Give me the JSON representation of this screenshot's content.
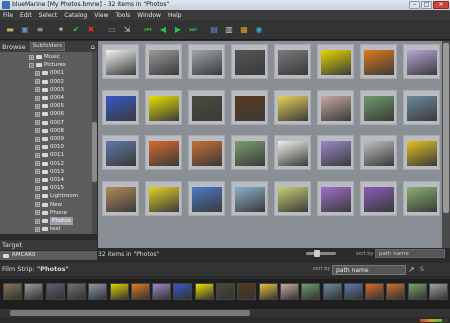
{
  "window": {
    "title": "blueMarine [My Photos.bmrw] - 32 items in \"Photos\""
  },
  "menu": [
    "File",
    "Edit",
    "Select",
    "Catalog",
    "View",
    "Tools",
    "Window",
    "Help"
  ],
  "toolbar": [
    {
      "icon": "folder-icon",
      "color": "#c9b26a"
    },
    {
      "icon": "save-icon",
      "color": "#6a8fc9"
    },
    {
      "icon": "list-icon",
      "color": "#bbbbbb"
    },
    {
      "icon": "star-icon",
      "color": "#cccccc"
    },
    {
      "icon": "check-icon",
      "color": "#3fbf3f"
    },
    {
      "icon": "delete-icon",
      "color": "#d83030"
    },
    {
      "icon": "monitor-icon",
      "color": "#5f8fd0"
    },
    {
      "icon": "export-icon",
      "color": "#cccccc"
    },
    {
      "icon": "first-icon",
      "color": "#2fbf4f"
    },
    {
      "icon": "previous-icon",
      "color": "#2fbf4f"
    },
    {
      "icon": "next-icon",
      "color": "#2fbf4f"
    },
    {
      "icon": "last-icon",
      "color": "#2fbf4f"
    },
    {
      "icon": "slideshow-icon",
      "color": "#5f8fd0"
    },
    {
      "icon": "filmstrip-icon",
      "color": "#cccccc"
    },
    {
      "icon": "color-icon",
      "color": "#d9a020"
    },
    {
      "icon": "globe-icon",
      "color": "#3fa0d0"
    }
  ],
  "browse": {
    "title": "Browse",
    "subfolders_label": "Subfolders",
    "tree": [
      {
        "label": "Music",
        "expanded": false
      },
      {
        "label": "Pictures",
        "expanded": true
      },
      {
        "label": "0001"
      },
      {
        "label": "0002"
      },
      {
        "label": "0003"
      },
      {
        "label": "0004"
      },
      {
        "label": "0005"
      },
      {
        "label": "0006"
      },
      {
        "label": "0007"
      },
      {
        "label": "0008"
      },
      {
        "label": "0009"
      },
      {
        "label": "0010"
      },
      {
        "label": "0011"
      },
      {
        "label": "0012"
      },
      {
        "label": "0013"
      },
      {
        "label": "0014"
      },
      {
        "label": "0015"
      },
      {
        "label": "Lightroom"
      },
      {
        "label": "New"
      },
      {
        "label": "Phone"
      },
      {
        "label": "Photos",
        "selected": true
      },
      {
        "label": "test"
      }
    ]
  },
  "target": {
    "title": "Target",
    "item": "RMCAR0"
  },
  "grid": {
    "status": "32 items in \"Photos\"",
    "sort_by_label": "sort by",
    "sort_value": "path name",
    "thumbnails": [
      "#f3f3ef",
      "#9a9a9a",
      "#9fa6ae",
      "#555555",
      "#7a7a7a",
      "#e4d600",
      "#e07a1a",
      "#b8a6d8",
      "#3558c9",
      "#e8e000",
      "#4a4a3a",
      "#5a3a1a",
      "#e6d15a",
      "#c7a9a0",
      "#6d9c6b",
      "#6a8aa0",
      "#5a7aa8",
      "#d8692a",
      "#c87030",
      "#7aa070",
      "#f0f0ea",
      "#9a8ac8",
      "#bfbfbf",
      "#e2c020",
      "#b48a5a",
      "#e2d020",
      "#4a7ac8",
      "#8ab0c8",
      "#c8d070",
      "#a070c8",
      "#8a5ab8",
      "#8ab070"
    ]
  },
  "film_strip": {
    "label": "Film Strip:",
    "folder": "\"Photos\"",
    "sort_by_label": "sort by",
    "sort_value": "path name",
    "size_label": "S",
    "thumbnails": [
      "#8a7050",
      "#9a9a9a",
      "#5a6070",
      "#707070",
      "#8a9aa8",
      "#e0d000",
      "#e07a1a",
      "#9a8ac8",
      "#3558c9",
      "#e8e000",
      "#4a4a3a",
      "#5a3a1a",
      "#e6c040",
      "#c7a9a0",
      "#6d9c6b",
      "#6a8aa0",
      "#5a7aa8",
      "#d8692a",
      "#c87030",
      "#7aa070",
      "#a0a0a0"
    ]
  },
  "progress": 0.78
}
